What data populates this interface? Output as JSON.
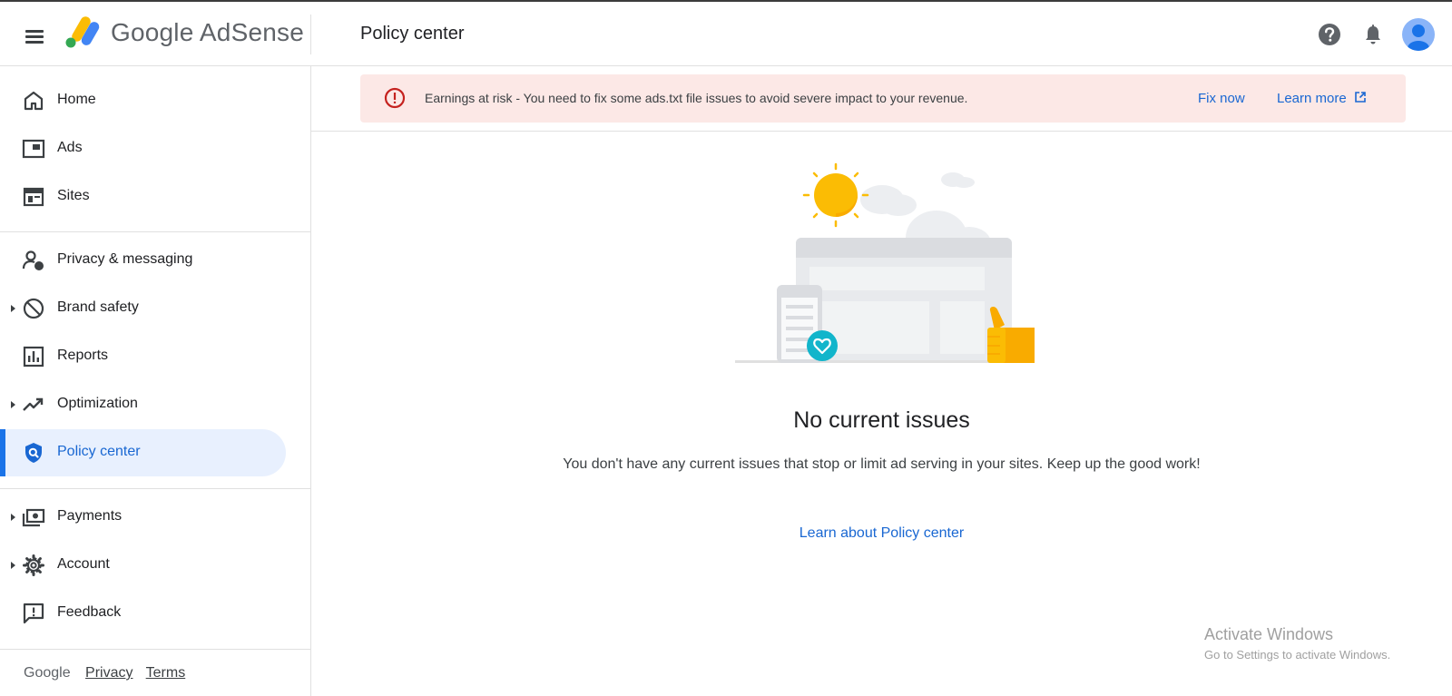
{
  "app": {
    "brand": "Google AdSense",
    "page_title": "Policy center"
  },
  "sidebar": {
    "items": [
      {
        "label": "Home",
        "icon": "home-icon",
        "expandable": false,
        "active": false
      },
      {
        "label": "Ads",
        "icon": "ads-icon",
        "expandable": false,
        "active": false
      },
      {
        "label": "Sites",
        "icon": "sites-icon",
        "expandable": false,
        "active": false
      },
      {
        "label": "Privacy & messaging",
        "icon": "privacy-messaging-icon",
        "expandable": false,
        "active": false
      },
      {
        "label": "Brand safety",
        "icon": "brand-safety-icon",
        "expandable": true,
        "active": false
      },
      {
        "label": "Reports",
        "icon": "reports-icon",
        "expandable": false,
        "active": false
      },
      {
        "label": "Optimization",
        "icon": "optimization-icon",
        "expandable": true,
        "active": false
      },
      {
        "label": "Policy center",
        "icon": "policy-center-icon",
        "expandable": false,
        "active": true
      },
      {
        "label": "Payments",
        "icon": "payments-icon",
        "expandable": true,
        "active": false
      },
      {
        "label": "Account",
        "icon": "account-gear-icon",
        "expandable": true,
        "active": false
      },
      {
        "label": "Feedback",
        "icon": "feedback-icon",
        "expandable": false,
        "active": false
      }
    ],
    "footer": {
      "google": "Google",
      "privacy": "Privacy",
      "terms": "Terms"
    }
  },
  "alert": {
    "text": "Earnings at risk - You need to fix some ads.txt file issues to avoid severe impact to your revenue.",
    "fix_label": "Fix now",
    "learn_label": "Learn more"
  },
  "main": {
    "title": "No current issues",
    "description": "You don't have any current issues that stop or limit ad serving in your sites. Keep up the good work!",
    "link": "Learn about Policy center"
  },
  "watermark": {
    "title": "Activate Windows",
    "subtitle": "Go to Settings to activate Windows."
  },
  "colors": {
    "accent": "#1a73e8",
    "link": "#1967d2",
    "alert_bg": "#fce8e6",
    "alert_icon": "#c5221f",
    "active_bg": "#e8f0fe"
  }
}
